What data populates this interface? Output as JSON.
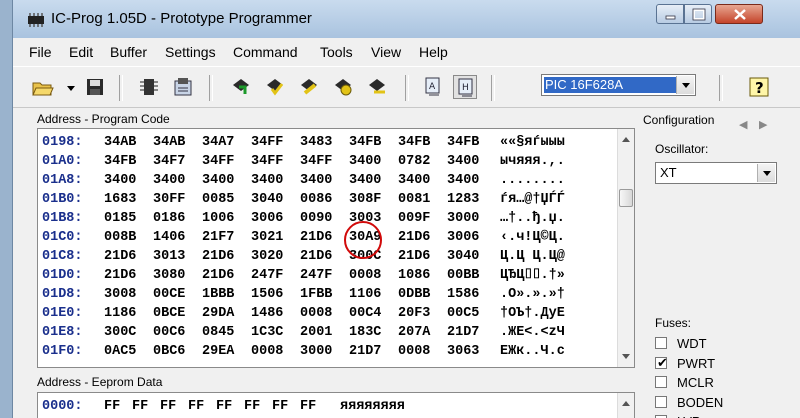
{
  "window": {
    "title": "IC-Prog 1.05D - Prototype Programmer"
  },
  "menu": [
    "File",
    "Edit",
    "Buffer",
    "Settings",
    "Command",
    "Tools",
    "View",
    "Help"
  ],
  "toolbar": {
    "device_selected": "PIC 16F628A",
    "icons": [
      "open-folder-icon",
      "dropdown-arrow-icon",
      "save-disk-icon",
      "chip-icon",
      "chip-settings-icon",
      "read-chip-icon",
      "program-chip-icon",
      "erase-chip-icon",
      "verify-chip-icon",
      "blank-check-icon",
      "view-asm-icon",
      "view-hex-icon",
      "help-icon"
    ]
  },
  "program_code": {
    "title": "Address - Program Code",
    "rows": [
      {
        "addr": "0198:",
        "words": [
          "34AB",
          "34AB",
          "34A7",
          "34FF",
          "3483",
          "34FB",
          "34FB",
          "34FB"
        ],
        "ascii": "««§яѓыыы"
      },
      {
        "addr": "01A0:",
        "words": [
          "34FB",
          "34F7",
          "34FF",
          "34FF",
          "34FF",
          "3400",
          "0782",
          "3400"
        ],
        "ascii": "ычяяя.,."
      },
      {
        "addr": "01A8:",
        "words": [
          "3400",
          "3400",
          "3400",
          "3400",
          "3400",
          "3400",
          "3400",
          "3400"
        ],
        "ascii": "........"
      },
      {
        "addr": "01B0:",
        "words": [
          "1683",
          "30FF",
          "0085",
          "3040",
          "0086",
          "308F",
          "0081",
          "1283"
        ],
        "ascii": "ѓя…@†ЏЃЃ"
      },
      {
        "addr": "01B8:",
        "words": [
          "0185",
          "0186",
          "1006",
          "3006",
          "0090",
          "3003",
          "009F",
          "3000"
        ],
        "ascii": "…†..ђ.џ."
      },
      {
        "addr": "01C0:",
        "words": [
          "008B",
          "1406",
          "21F7",
          "3021",
          "21D6",
          "30A9",
          "21D6",
          "3006"
        ],
        "ascii": "‹.ч!Ц©Ц."
      },
      {
        "addr": "01C8:",
        "words": [
          "21D6",
          "3013",
          "21D6",
          "3020",
          "21D6",
          "300C",
          "21D6",
          "3040"
        ],
        "ascii": "Ц.Ц Ц.Ц@"
      },
      {
        "addr": "01D0:",
        "words": [
          "21D6",
          "3080",
          "21D6",
          "247F",
          "247F",
          "0008",
          "1086",
          "00BB"
        ],
        "ascii": "ЦЂЦ⌷⌷.†»"
      },
      {
        "addr": "01D8:",
        "words": [
          "3008",
          "00CE",
          "1BBB",
          "1506",
          "1FBB",
          "1106",
          "0DBB",
          "1586"
        ],
        "ascii": ".О».».»†"
      },
      {
        "addr": "01E0:",
        "words": [
          "1186",
          "0BCE",
          "29DA",
          "1486",
          "0008",
          "00C4",
          "20F3",
          "00C5"
        ],
        "ascii": "†ОЪ†.ДуЕ"
      },
      {
        "addr": "01E8:",
        "words": [
          "300C",
          "00C6",
          "0845",
          "1C3C",
          "2001",
          "183C",
          "207A",
          "21D7"
        ],
        "ascii": ".ЖЕ<.<zЧ"
      },
      {
        "addr": "01F0:",
        "words": [
          "0AC5",
          "0BC6",
          "29EA",
          "0008",
          "3000",
          "21D7",
          "0008",
          "3063"
        ],
        "ascii": "ЕЖк..Ч.c"
      }
    ]
  },
  "eeprom": {
    "title": "Address - Eeprom Data",
    "rows": [
      {
        "addr": "0000:",
        "bytes": [
          "FF",
          "FF",
          "FF",
          "FF",
          "FF",
          "FF",
          "FF",
          "FF"
        ],
        "ascii": "яяяяяяяя"
      }
    ]
  },
  "configuration": {
    "title": "Configuration",
    "oscillator_label": "Oscillator:",
    "oscillator_value": "XT",
    "fuses_label": "Fuses:",
    "fuses": [
      {
        "name": "WDT",
        "checked": false
      },
      {
        "name": "PWRT",
        "checked": true
      },
      {
        "name": "MCLR",
        "checked": false
      },
      {
        "name": "BODEN",
        "checked": false
      },
      {
        "name": "LVP",
        "checked": false
      }
    ]
  },
  "colors": {
    "address": "#1a2f8c",
    "highlight_circle": "#d10a0a",
    "selection": "#3169c6"
  }
}
